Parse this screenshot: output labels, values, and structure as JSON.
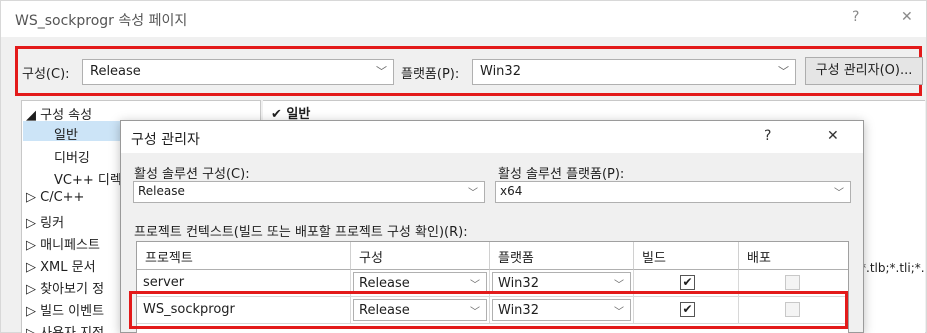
{
  "window": {
    "title": "WS_sockprogr 속성 페이지",
    "help_glyph": "?",
    "close_glyph": "✕"
  },
  "config_bar": {
    "config_label": "구성(C):",
    "config_value": "Release",
    "platform_label": "플랫폼(P):",
    "platform_value": "Win32",
    "manager_button": "구성 관리자(O)..."
  },
  "tree": {
    "items": [
      "◢ 구성 속성",
      "일반",
      "디버깅",
      "VC++ 디렉",
      "▷ C/C++",
      "▷ 링커",
      "▷ 매니페스트",
      "▷ XML 문서",
      "▷ 찾아보기 정",
      "▷ 빌드 이벤트",
      "▷ 사용자 지정"
    ]
  },
  "right_panel": {
    "header": "✔ 일반",
    "snippet": "*.tlb;*.tli;*."
  },
  "dialog": {
    "title": "구성 관리자",
    "help_glyph": "?",
    "close_glyph": "✕",
    "active_solution_config_label": "활성 솔루션 구성(C):",
    "active_solution_config_value": "Release",
    "active_solution_platform_label": "활성 솔루션 플랫폼(P):",
    "active_solution_platform_value": "x64",
    "project_contexts_label": "프로젝트 컨텍스트(빌드 또는 배포할 프로젝트 구성 확인)(R):",
    "columns": [
      "프로젝트",
      "구성",
      "플랫폼",
      "빌드",
      "배포"
    ],
    "rows": [
      {
        "project": "server",
        "config": "Release",
        "platform": "Win32",
        "build": "✔",
        "deploy": ""
      },
      {
        "project": "WS_sockprogr",
        "config": "Release",
        "platform": "Win32",
        "build": "✔",
        "deploy": ""
      }
    ]
  },
  "colors": {
    "highlight_red": "#e31a1a",
    "selection_blue": "#cce4f7"
  }
}
